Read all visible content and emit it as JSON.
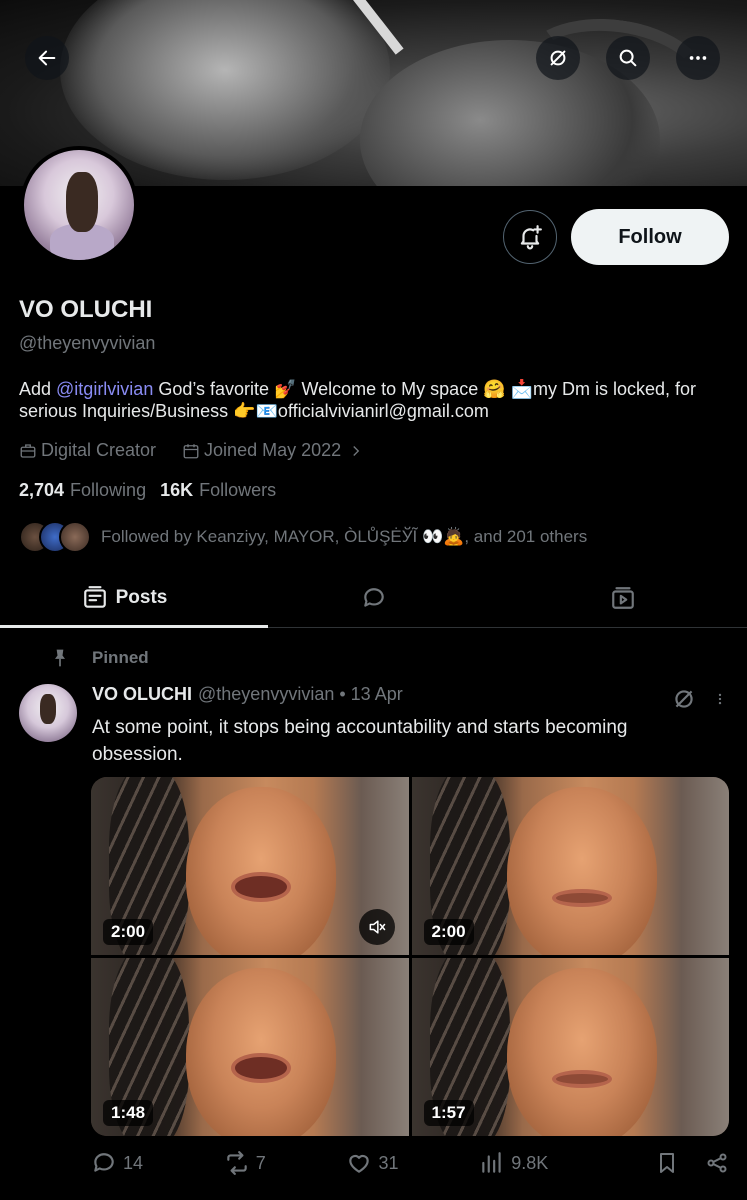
{
  "colors": {
    "background": "#000000",
    "text": "#e7e9ea",
    "muted": "#71767b",
    "mention": "#8a8cf4",
    "follow_bg": "#eff3f4"
  },
  "header": {
    "back_icon": "arrow-left-icon",
    "grok_icon": "grok-icon",
    "search_icon": "search-icon",
    "more_icon": "more-icon"
  },
  "profile": {
    "name": "VO OLUCHI",
    "handle": "@theyenvyvivian",
    "follow_label": "Follow",
    "bio": {
      "prefix": "Add ",
      "mention": "@itgirlvivian",
      "rest": " God’s favorite 💅 Welcome to My space 🤗 📩my Dm is locked, for serious Inquiries/Business 👉📧officialvivianirl@gmail.com"
    },
    "category": "Digital Creator",
    "joined": "Joined May 2022",
    "following_count": "2,704",
    "following_label": "Following",
    "followers_count": "16K",
    "followers_label": "Followers",
    "followed_by": "Followed by Keanziyy, MAYOR, ÒLŮŞĖЎĨ 👀🙇, and 201 others"
  },
  "tabs": [
    {
      "label": "Posts",
      "icon": "posts-icon"
    },
    {
      "label": "",
      "icon": "replies-icon"
    },
    {
      "label": "",
      "icon": "media-icon"
    }
  ],
  "post": {
    "pinned_label": "Pinned",
    "author": "VO OLUCHI",
    "handle": "@theyenvyvivian",
    "separator": "•",
    "date": "13 Apr",
    "text": "At some point, it stops being accountability and starts becoming obsession.",
    "videos": [
      {
        "duration": "2:00"
      },
      {
        "duration": "2:00"
      },
      {
        "duration": "1:48"
      },
      {
        "duration": "1:57"
      }
    ],
    "replies": "14",
    "reposts": "7",
    "likes": "31",
    "views": "9.8K"
  }
}
